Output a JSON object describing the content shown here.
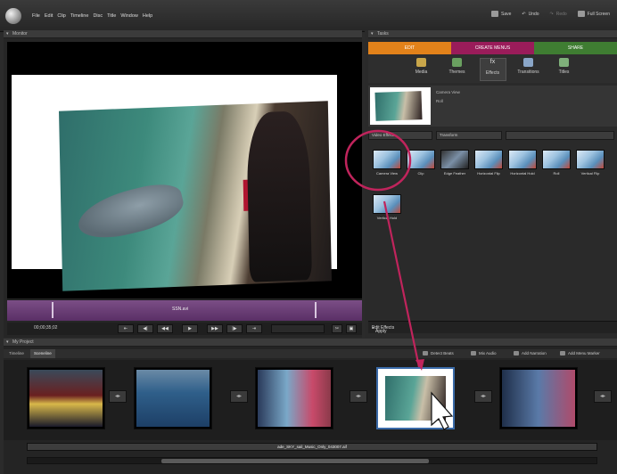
{
  "app": {
    "menus": [
      "File",
      "Edit",
      "Clip",
      "Timeline",
      "Disc",
      "Title",
      "Window",
      "Help"
    ],
    "tools": {
      "save": "Save",
      "undo": "Undo",
      "redo": "Redo",
      "fullscreen": "Full Screen"
    }
  },
  "monitor": {
    "title": "Monitor",
    "clip_name": "SSN.avi",
    "timecode": "00;00;35;02"
  },
  "tasks": {
    "title": "Tasks",
    "tabs": {
      "edit": "EDIT",
      "create_menus": "CREATE MENUS",
      "share": "SHARE"
    },
    "subtabs": {
      "media": "Media",
      "themes": "Themes",
      "effects": "Effects",
      "transitions": "Transitions",
      "titles": "Titles"
    },
    "preview_rows": [
      "Camera View",
      "Roll"
    ],
    "dropdowns": {
      "category": "Video Effects",
      "subcategory": "Transform"
    },
    "effects": [
      "Camera View",
      "Clip",
      "Edge Feather",
      "Horizontal Flip",
      "Horizontal Hold",
      "Roll",
      "Vertical Flip",
      "Vertical Hold"
    ],
    "edit_effects": "Edit Effects",
    "apply": "Apply"
  },
  "project": {
    "title": "My Project",
    "tabs": {
      "timeline": "Timeline",
      "sceneline": "Sceneline"
    },
    "actions": {
      "detect_beats": "Detect Beats",
      "mix_audio": "Mix Audio",
      "add_narration": "Add Narration",
      "add_menu_marker": "Add Menu Marker"
    },
    "audio_file": "ade_SKY_sail_Music_Only_043007.aif"
  },
  "colors": {
    "edit": "#e2821a",
    "create_menus": "#9a1c5a",
    "share": "#3f7d32",
    "annotation": "#c0245c"
  }
}
